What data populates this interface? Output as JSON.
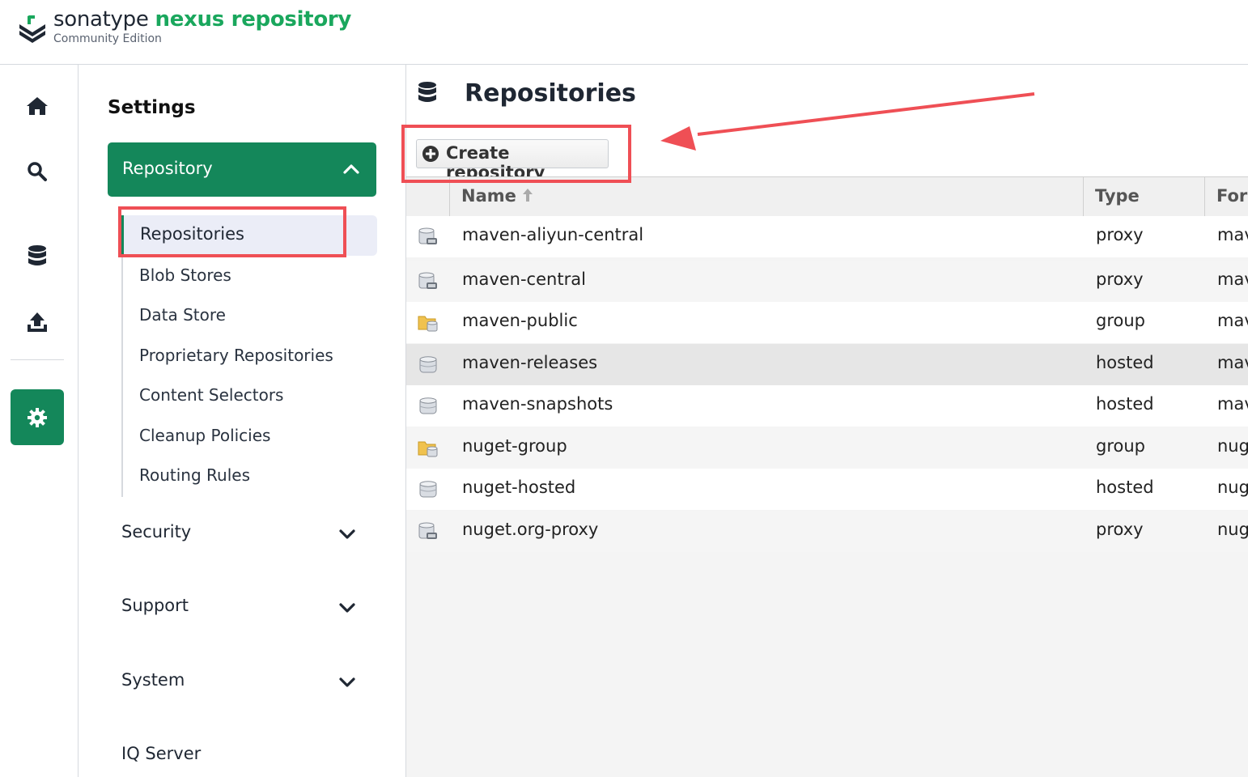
{
  "header": {
    "brand_part1": "sonatype",
    "brand_part2": "nexus repository",
    "edition": "Community Edition"
  },
  "rail": {
    "items": [
      {
        "icon": "home-icon",
        "active": false
      },
      {
        "icon": "search-icon",
        "active": false
      },
      {
        "icon": "database-icon",
        "active": false
      },
      {
        "icon": "upload-icon",
        "active": false
      },
      {
        "icon": "gear-icon",
        "active": true
      }
    ]
  },
  "nav": {
    "title": "Settings",
    "open_section": "Repository",
    "items": [
      "Repositories",
      "Blob Stores",
      "Data Store",
      "Proprietary Repositories",
      "Content Selectors",
      "Cleanup Policies",
      "Routing Rules"
    ],
    "active_item": "Repositories",
    "collapsed_sections": [
      "Security",
      "Support",
      "System",
      "IQ Server"
    ]
  },
  "main": {
    "title": "Repositories",
    "create_button": "Create repository",
    "columns": {
      "name": "Name",
      "type": "Type",
      "format": "For"
    },
    "rows": [
      {
        "name": "maven-aliyun-central",
        "type": "proxy",
        "format": "mav",
        "icon": "proxy-repo-icon"
      },
      {
        "name": "maven-central",
        "type": "proxy",
        "format": "mav",
        "icon": "proxy-repo-icon"
      },
      {
        "name": "maven-public",
        "type": "group",
        "format": "mav",
        "icon": "group-repo-icon"
      },
      {
        "name": "maven-releases",
        "type": "hosted",
        "format": "mav",
        "icon": "hosted-repo-icon"
      },
      {
        "name": "maven-snapshots",
        "type": "hosted",
        "format": "mav",
        "icon": "hosted-repo-icon"
      },
      {
        "name": "nuget-group",
        "type": "group",
        "format": "nug",
        "icon": "group-repo-icon"
      },
      {
        "name": "nuget-hosted",
        "type": "hosted",
        "format": "nug",
        "icon": "hosted-repo-icon"
      },
      {
        "name": "nuget.org-proxy",
        "type": "proxy",
        "format": "nug",
        "icon": "proxy-repo-icon"
      }
    ]
  },
  "colors": {
    "brand_green": "#14875a",
    "logo_green": "#1aa75d",
    "annotation_red": "#ef4f55"
  }
}
